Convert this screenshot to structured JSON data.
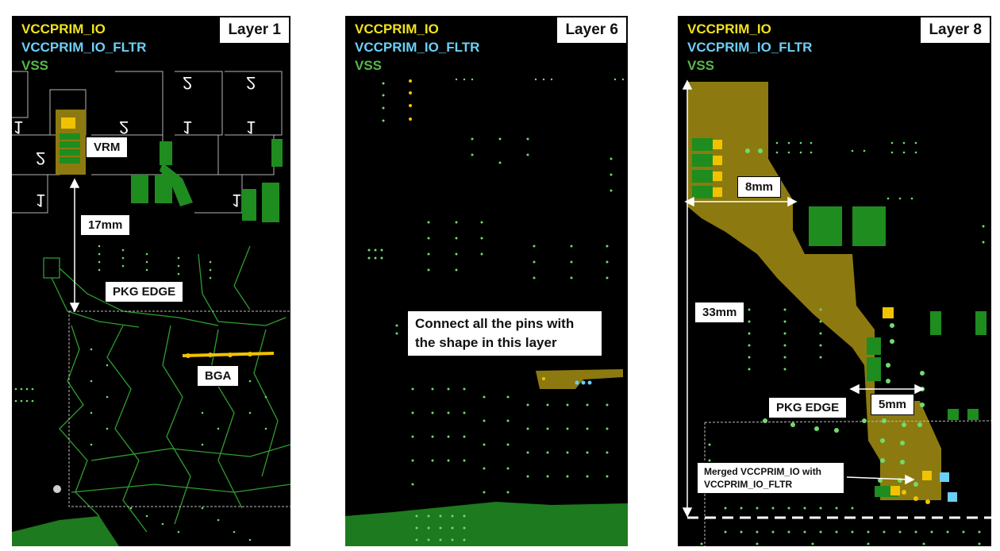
{
  "legend": {
    "vccprim_io": "VCCPRIM_IO",
    "vccprim_io_fltr": "VCCPRIM_IO_FLTR",
    "vss": "VSS"
  },
  "colors": {
    "vccprim_io": "#f2e21b",
    "vccprim_io_fltr": "#6ccff6",
    "vss": "#57b847",
    "copper_shape": "#8c7a10",
    "background": "#000000"
  },
  "panels": [
    {
      "layer": "Layer 1",
      "labels": {
        "vrm": "VRM",
        "distance": "17mm",
        "pkg_edge": "PKG EDGE",
        "bga": "BGA"
      }
    },
    {
      "layer": "Layer 6",
      "labels": {
        "note": "Connect all the pins with the shape in this layer"
      }
    },
    {
      "layer": "Layer 8",
      "labels": {
        "width_top": "8mm",
        "length": "33mm",
        "width_bottom": "5mm",
        "pkg_edge": "PKG EDGE",
        "merged_note": "Merged VCCPRIM_IO with VCCPRIM_IO_FLTR"
      }
    }
  ]
}
